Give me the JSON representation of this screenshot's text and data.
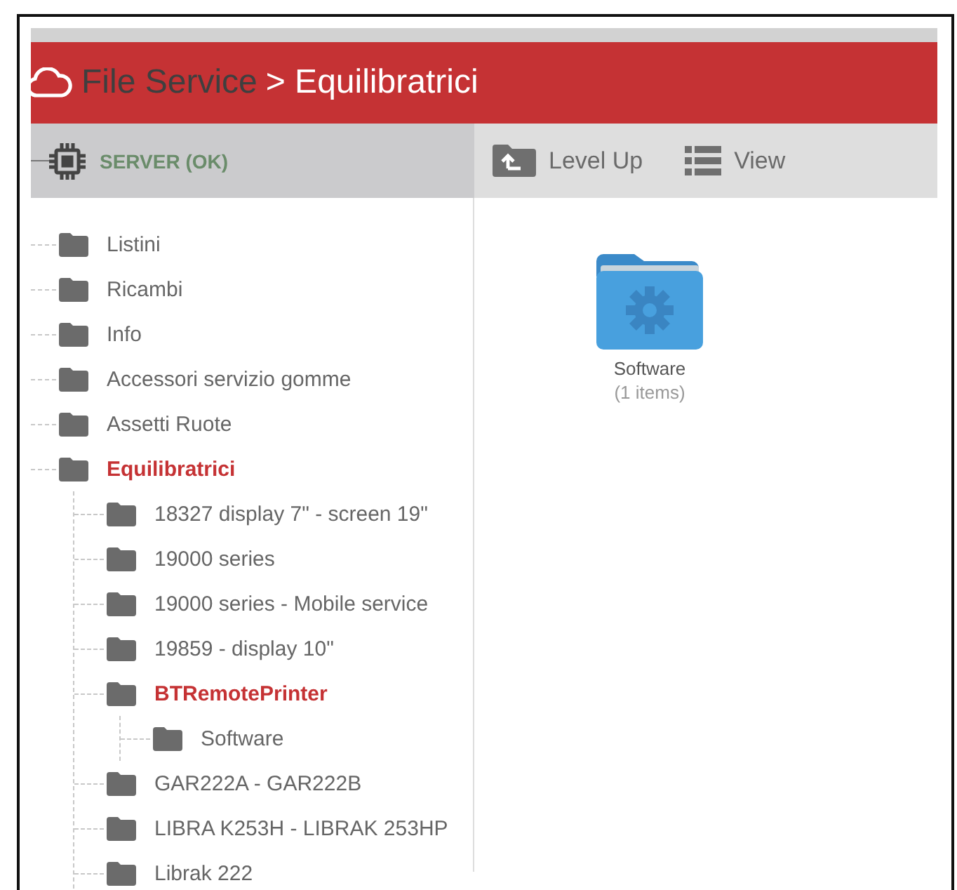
{
  "header": {
    "app_name": "File Service",
    "breadcrumb": "> Equilibratrici"
  },
  "server": {
    "label": "SERVER (OK)"
  },
  "toolbar": {
    "buttons": [
      {
        "kind": "level_up",
        "label": "Level Up"
      },
      {
        "kind": "view",
        "label": "View"
      }
    ]
  },
  "tree": [
    {
      "label": "Listini",
      "selected": false
    },
    {
      "label": "Ricambi",
      "selected": false
    },
    {
      "label": "Info",
      "selected": false
    },
    {
      "label": "Accessori servizio gomme",
      "selected": false
    },
    {
      "label": "Assetti Ruote",
      "selected": false
    },
    {
      "label": "Equilibratrici",
      "selected": true,
      "children": [
        {
          "label": "18327 display 7\" - screen 19\"",
          "selected": false
        },
        {
          "label": "19000 series",
          "selected": false
        },
        {
          "label": "19000 series - Mobile service",
          "selected": false
        },
        {
          "label": "19859 - display 10\"",
          "selected": false
        },
        {
          "label": "BTRemotePrinter",
          "selected": true,
          "children": [
            {
              "label": "Software",
              "selected": false
            }
          ]
        },
        {
          "label": "GAR222A - GAR222B",
          "selected": false
        },
        {
          "label": "LIBRA K253H - LIBRAK 253HP",
          "selected": false
        },
        {
          "label": "Librak 222",
          "selected": false
        }
      ]
    }
  ],
  "content": {
    "items": [
      {
        "name": "Software",
        "count": "(1 items)"
      }
    ]
  }
}
